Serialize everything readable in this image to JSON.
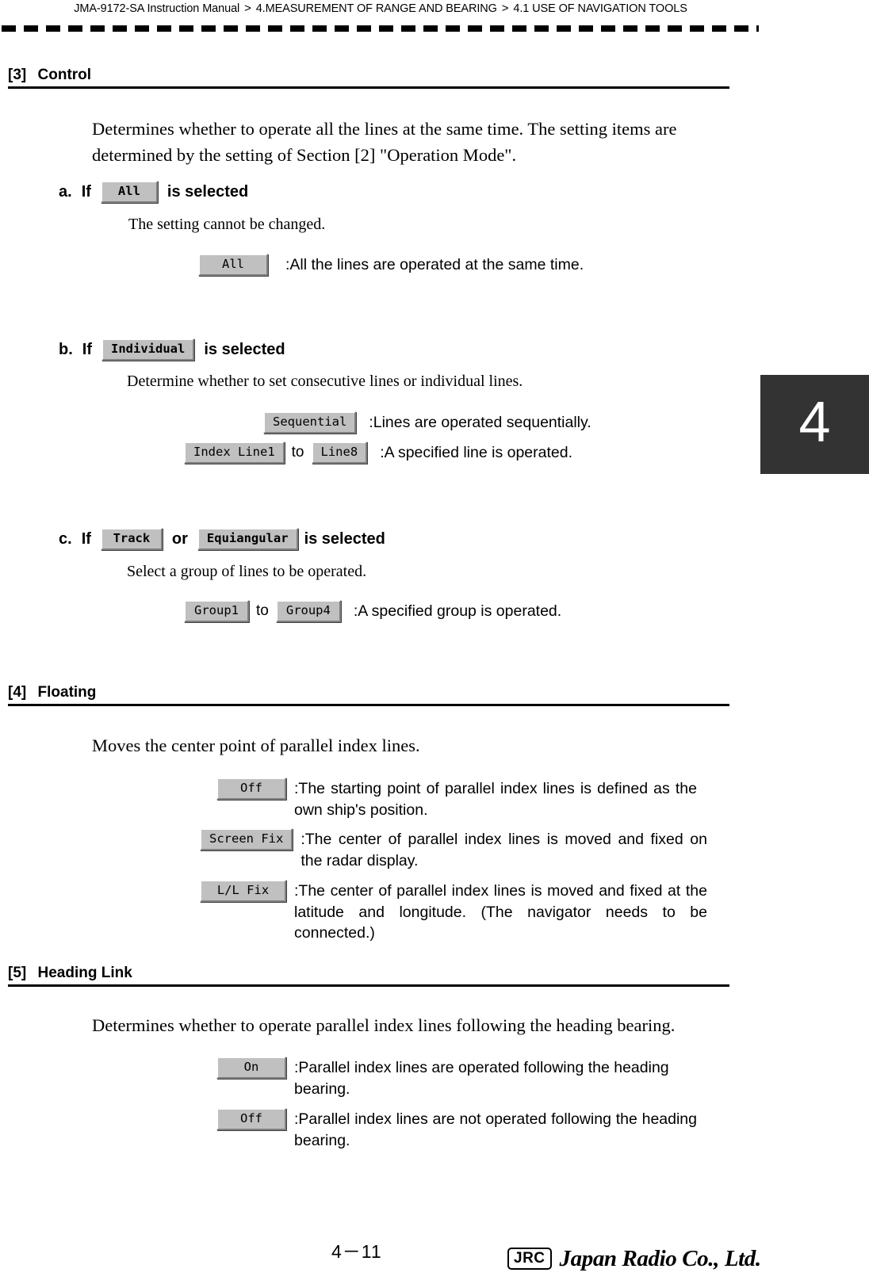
{
  "header": {
    "manual": "JMA-9172-SA Instruction Manual",
    "separator": ">",
    "chapter": "4.MEASUREMENT OF RANGE AND BEARING",
    "section": "4.1  USE OF NAVIGATION TOOLS"
  },
  "chapter_tab": {
    "number": "4"
  },
  "sections": {
    "control": {
      "num": "[3]",
      "title": "Control",
      "intro": "Determines whether to operate all the lines at the same time. The setting items are determined by the setting of Section [2] \"Operation Mode\".",
      "a": {
        "letter": "a.",
        "if": "If",
        "button": "All",
        "tail": "is selected",
        "note": "The setting cannot be changed.",
        "options": [
          {
            "button": "All",
            "desc": ":All the lines are operated at the same time."
          }
        ]
      },
      "b": {
        "letter": "b.",
        "if": "If",
        "button": "Individual",
        "tail": "is selected",
        "note": "Determine whether to set consecutive lines or individual lines.",
        "options": [
          {
            "button": "Sequential",
            "desc": ":Lines are operated sequentially."
          },
          {
            "button": "Index Line1",
            "connector": "to",
            "button2": "Line8",
            "desc": ":A specified line is operated."
          }
        ]
      },
      "c": {
        "letter": "c.",
        "if": "If",
        "button": "Track",
        "mid": "or",
        "button2": "Equiangular",
        "tail": "is selected",
        "note": "Select a group of lines to be operated.",
        "options": [
          {
            "button": "Group1",
            "connector": "to",
            "button2": "Group4",
            "desc": ":A specified group is operated."
          }
        ]
      }
    },
    "floating": {
      "num": "[4]",
      "title": "Floating",
      "intro": "Moves the center point of parallel index lines.",
      "options": [
        {
          "button": "Off",
          "desc": ":The starting point of parallel index lines is defined as the own ship's position."
        },
        {
          "button": "Screen Fix",
          "desc": ":The center of parallel index lines is moved and fixed on the radar display."
        },
        {
          "button": "L/L Fix",
          "desc": ":The center of parallel index lines is moved and fixed at the latitude and longitude. (The navigator needs to be connected.)"
        }
      ]
    },
    "heading_link": {
      "num": "[5]",
      "title": "Heading Link",
      "intro": "Determines whether to operate parallel index lines following the heading bearing.",
      "options": [
        {
          "button": "On",
          "desc": ":Parallel index lines are operated following the heading bearing."
        },
        {
          "button": "Off",
          "desc": ":Parallel index lines are not operated following the heading bearing."
        }
      ]
    }
  },
  "footer": {
    "page_number": "4－11",
    "logo_mark": "JRC",
    "company": "Japan Radio Co., Ltd."
  }
}
